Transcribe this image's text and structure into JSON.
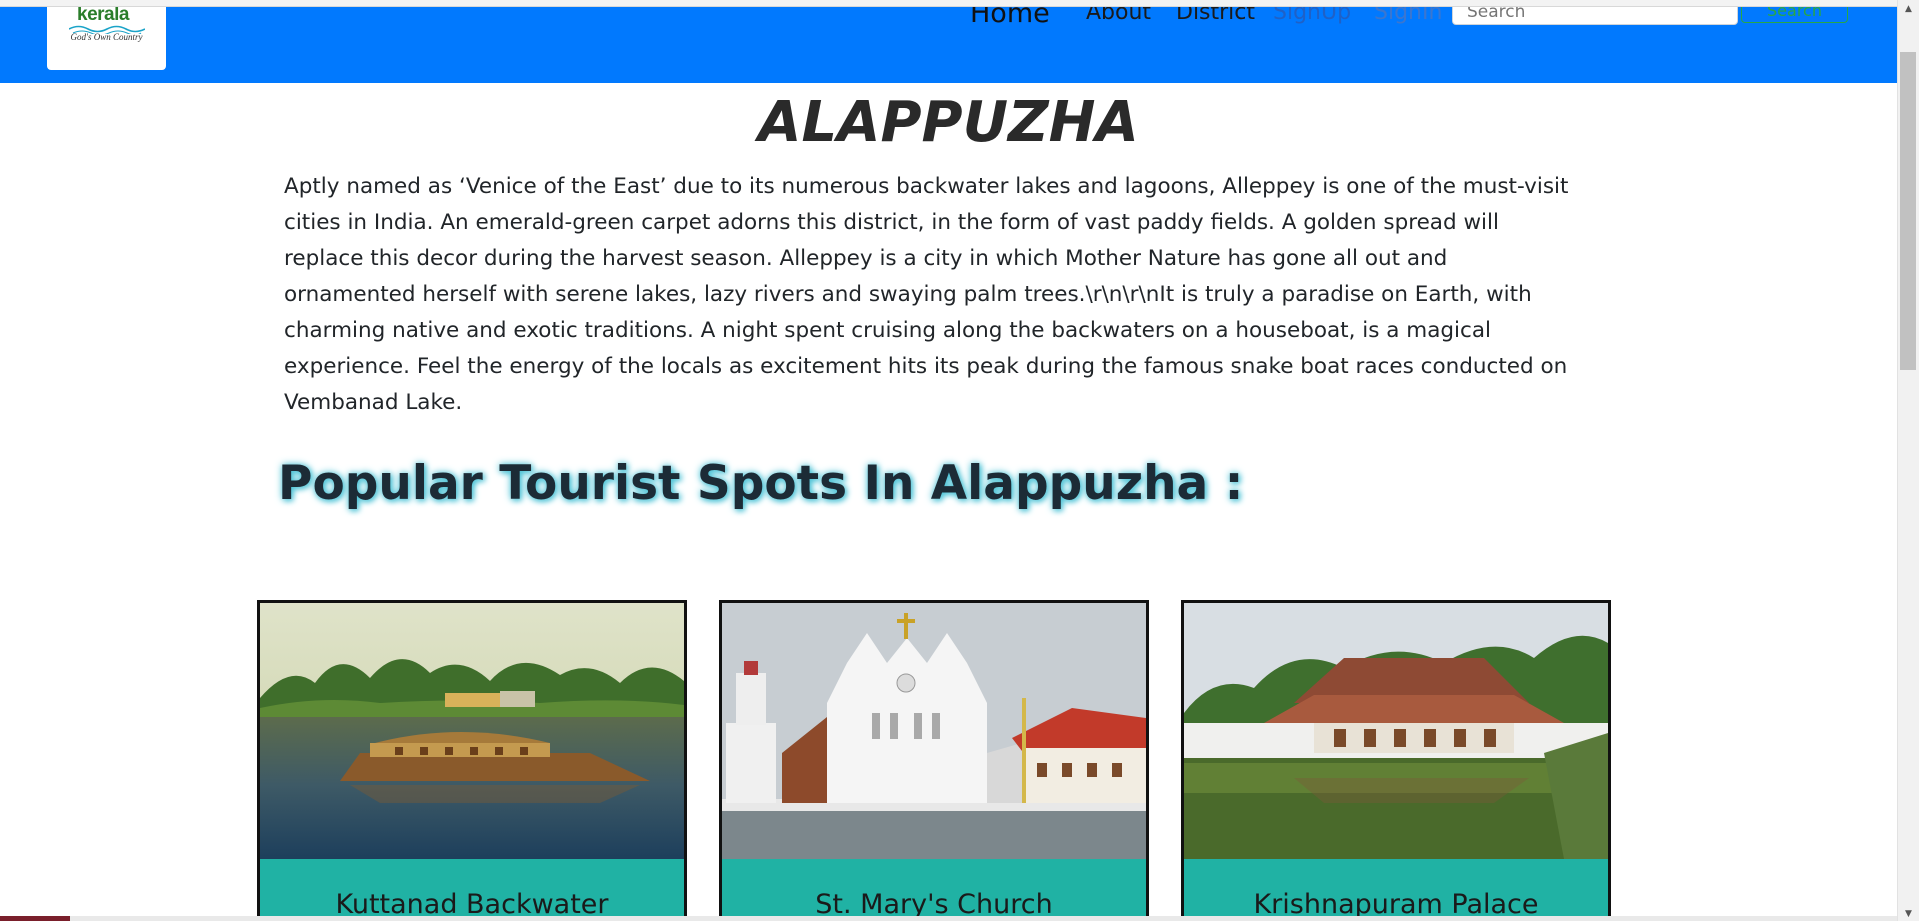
{
  "header": {
    "logo_text": "kerala",
    "logo_tagline": "God's Own Country",
    "nav": {
      "home": "Home",
      "about": "About",
      "district": "District",
      "signup": "SignUp",
      "signin": "SignIn"
    },
    "search_placeholder": "Search",
    "search_button": "Search"
  },
  "main": {
    "title": "ALAPPUZHA",
    "description": "Aptly named as ‘Venice of the East’ due to its numerous backwater lakes and lagoons, Alleppey is one of the must-visit cities in India. An emerald-green carpet adorns this district, in the form of vast paddy fields. A golden spread will replace this decor during the harvest season. Alleppey is a city in which Mother Nature has gone all out and ornamented herself with serene lakes, lazy rivers and swaying palm trees.\\r\\n\\r\\nIt is truly a paradise on Earth, with charming native and exotic traditions. A night spent cruising along the backwaters on a houseboat, is a magical experience. Feel the energy of the locals as excitement hits its peak during the famous snake boat races conducted on Vembanad Lake.",
    "spots_heading": "Popular Tourist Spots In Alappuzha :",
    "spots": [
      {
        "name": "Kuttanad Backwater"
      },
      {
        "name": "St. Mary's Church"
      },
      {
        "name": "Krishnapuram Palace"
      }
    ]
  },
  "colors": {
    "navbar": "#0179fe",
    "card_footer": "#20b2a4",
    "search_accent": "#28a745"
  }
}
